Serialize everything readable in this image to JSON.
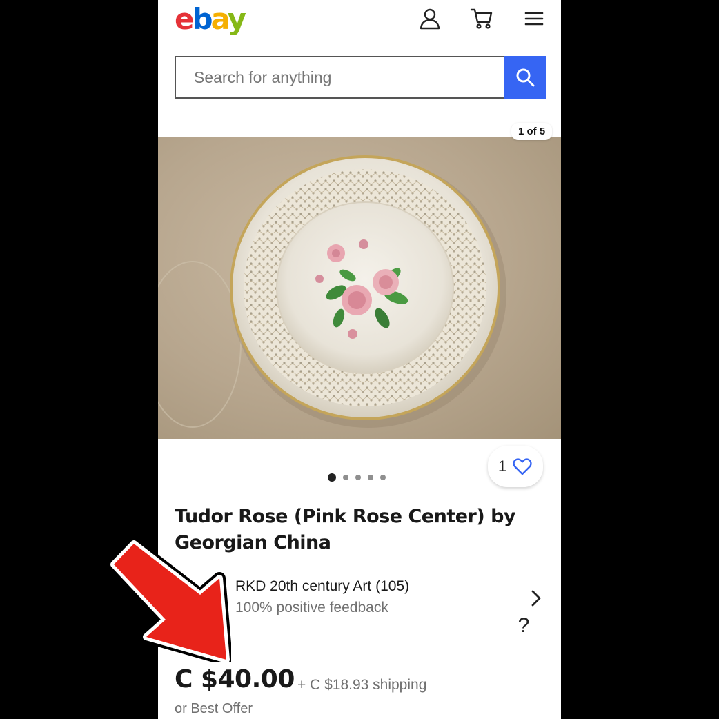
{
  "header": {
    "logo_letters": [
      "e",
      "b",
      "a",
      "y"
    ],
    "account_icon": "account-icon",
    "cart_icon": "cart-icon",
    "menu_icon": "hamburger-menu-icon"
  },
  "search": {
    "placeholder": "Search for anything",
    "button_icon": "search-icon",
    "button_color": "#3665f3"
  },
  "gallery": {
    "counter": "1 of 5",
    "total_dots": 5,
    "active_dot": 1,
    "watch_count": "1"
  },
  "item": {
    "title": "Tudor Rose (Pink Rose Center) by Georgian China"
  },
  "seller": {
    "name": "RKD 20th century Art (105)",
    "feedback": "100% positive feedback",
    "help": "?"
  },
  "pricing": {
    "price": "C $40.00",
    "shipping": "+ C $18.93 shipping",
    "best_offer": "or Best Offer"
  },
  "annotation": {
    "arrow_color": "#e8231a"
  }
}
